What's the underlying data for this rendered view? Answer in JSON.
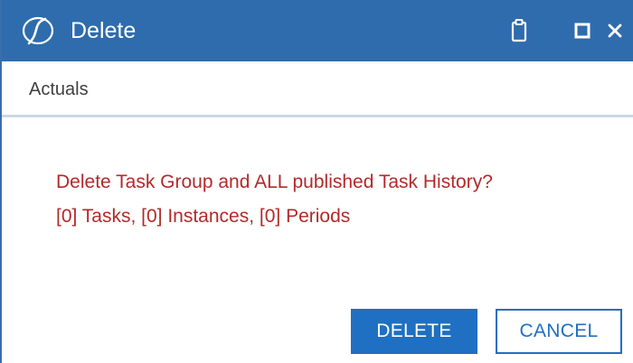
{
  "window": {
    "title": "Delete",
    "icons": [
      "app-logo-icon",
      "clipboard-icon",
      "maximize-icon",
      "close-icon"
    ]
  },
  "subheader": {
    "label": "Actuals"
  },
  "message": {
    "line1": "Delete Task Group and ALL published Task History?",
    "line2": "[0] Tasks, [0] Instances, [0] Periods"
  },
  "buttons": {
    "delete_label": "DELETE",
    "cancel_label": "CANCEL"
  },
  "colors": {
    "titlebar": "#2f6cad",
    "message_text": "#b22a2a",
    "primary_button": "#1f6fc2",
    "subheader_border": "#c9d8ea"
  }
}
